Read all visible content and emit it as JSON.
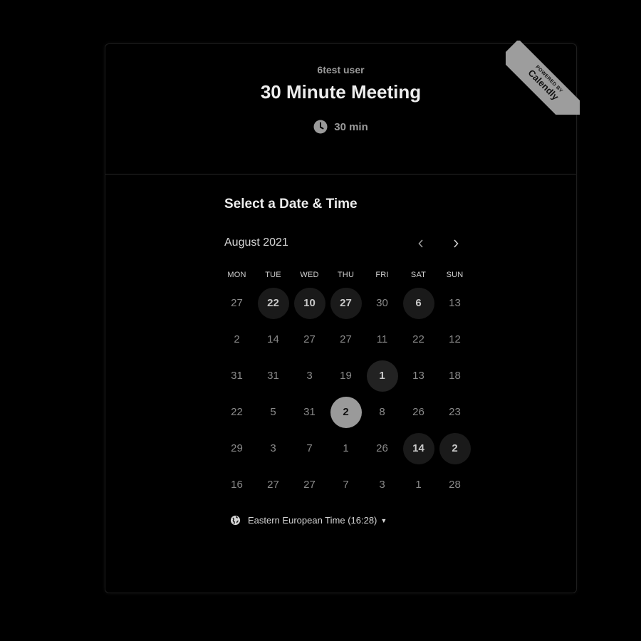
{
  "header": {
    "host": "6test user",
    "title": "30 Minute Meeting",
    "duration": "30 min"
  },
  "ribbon": {
    "small": "POWERED BY",
    "brand": "Calendly"
  },
  "section_title": "Select a Date & Time",
  "calendar": {
    "month": "August 2021",
    "weekdays": [
      "MON",
      "TUE",
      "WED",
      "THU",
      "FRI",
      "SAT",
      "SUN"
    ],
    "days": [
      {
        "label": "27",
        "state": "unavailable"
      },
      {
        "label": "22",
        "state": "available"
      },
      {
        "label": "10",
        "state": "available"
      },
      {
        "label": "27",
        "state": "available"
      },
      {
        "label": "30",
        "state": "unavailable"
      },
      {
        "label": "6",
        "state": "available"
      },
      {
        "label": "13",
        "state": "unavailable"
      },
      {
        "label": "2",
        "state": "unavailable"
      },
      {
        "label": "14",
        "state": "unavailable"
      },
      {
        "label": "27",
        "state": "unavailable"
      },
      {
        "label": "27",
        "state": "unavailable"
      },
      {
        "label": "11",
        "state": "unavailable"
      },
      {
        "label": "22",
        "state": "unavailable"
      },
      {
        "label": "12",
        "state": "unavailable"
      },
      {
        "label": "31",
        "state": "unavailable"
      },
      {
        "label": "31",
        "state": "unavailable"
      },
      {
        "label": "3",
        "state": "unavailable"
      },
      {
        "label": "19",
        "state": "unavailable"
      },
      {
        "label": "1",
        "state": "available2"
      },
      {
        "label": "13",
        "state": "unavailable"
      },
      {
        "label": "18",
        "state": "unavailable"
      },
      {
        "label": "22",
        "state": "unavailable"
      },
      {
        "label": "5",
        "state": "unavailable"
      },
      {
        "label": "31",
        "state": "unavailable"
      },
      {
        "label": "2",
        "state": "selected"
      },
      {
        "label": "8",
        "state": "unavailable"
      },
      {
        "label": "26",
        "state": "unavailable"
      },
      {
        "label": "23",
        "state": "unavailable"
      },
      {
        "label": "29",
        "state": "unavailable"
      },
      {
        "label": "3",
        "state": "unavailable"
      },
      {
        "label": "7",
        "state": "unavailable"
      },
      {
        "label": "1",
        "state": "unavailable"
      },
      {
        "label": "26",
        "state": "unavailable"
      },
      {
        "label": "14",
        "state": "available"
      },
      {
        "label": "2",
        "state": "available"
      },
      {
        "label": "16",
        "state": "unavailable"
      },
      {
        "label": "27",
        "state": "unavailable"
      },
      {
        "label": "27",
        "state": "unavailable"
      },
      {
        "label": "7",
        "state": "unavailable"
      },
      {
        "label": "3",
        "state": "unavailable"
      },
      {
        "label": "1",
        "state": "unavailable"
      },
      {
        "label": "28",
        "state": "unavailable"
      }
    ]
  },
  "timezone": {
    "label": "Eastern European Time (16:28)"
  },
  "icons": {
    "clock": "clock-icon",
    "prev": "chevron-left-icon",
    "next": "chevron-right-icon",
    "globe": "globe-icon",
    "caret": "caret-down-icon"
  }
}
